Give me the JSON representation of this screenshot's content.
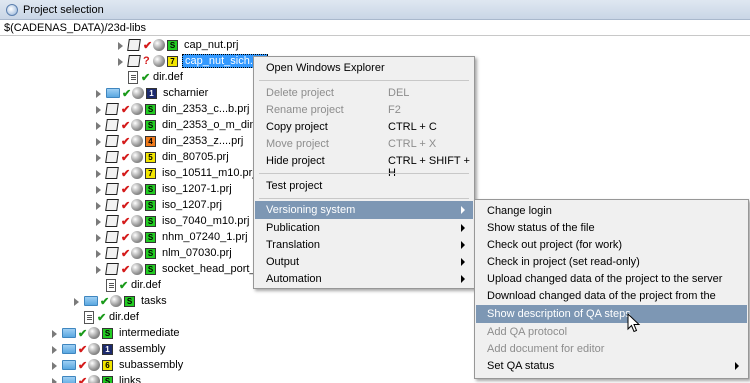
{
  "window": {
    "title": "Project selection"
  },
  "path": "$(CADENAS_DATA)/23d-libs",
  "tree": {
    "cap_nut": "cap_nut.prj",
    "cap_nut_sich": "cap_nut_sich.prj",
    "dirdef1": "dir.def",
    "scharnier": "scharnier",
    "din_2353_cb": "din_2353_c...b.prj",
    "din_2353_omdin": "din_2353_o_m_din_235",
    "din_2353_z": "din_2353_z....prj",
    "din_80705": "din_80705.prj",
    "iso_10511": "iso_10511_m10.prj",
    "iso_1207_1": "iso_1207-1.prj",
    "iso_1207": "iso_1207.prj",
    "iso_7040": "iso_7040_m10.prj",
    "nhm_07240": "nhm_07240_1.prj",
    "nlm_07030": "nlm_07030.prj",
    "socket": "socket_head_port_plug",
    "dirdef2": "dir.def",
    "tasks": "tasks",
    "dirdef3": "dir.def",
    "intermediate": "intermediate",
    "assembly": "assembly",
    "subassembly": "subassembly",
    "links": "links",
    "badges": {
      "cap_nut": "S",
      "cap_nut_sich": "7",
      "scharnier": "1",
      "din_2353_cb": "S",
      "din_2353_omdin": "S",
      "din_2353_z": "4",
      "din_80705": "5",
      "iso_10511": "7",
      "iso_1207_1": "S",
      "iso_1207": "S",
      "iso_7040": "S",
      "nhm_07240": "S",
      "nlm_07030": "S",
      "socket": "S",
      "tasks": "S",
      "intermediate": "S",
      "assembly": "1",
      "subassembly": "6",
      "links": "S"
    },
    "question_mark": "?"
  },
  "context_menu": {
    "open_explorer": "Open Windows Explorer",
    "delete": "Delete project",
    "delete_sc": "DEL",
    "rename": "Rename project",
    "rename_sc": "F2",
    "copy": "Copy project",
    "copy_sc": "CTRL + C",
    "move": "Move project",
    "move_sc": "CTRL + X",
    "hide": "Hide project",
    "hide_sc": "CTRL + SHIFT + H",
    "test": "Test project",
    "versioning": "Versioning system",
    "publication": "Publication",
    "translation": "Translation",
    "output": "Output",
    "automation": "Automation"
  },
  "submenu": {
    "change_login": "Change login",
    "show_status": "Show status of the file",
    "check_out": "Check out project (for work)",
    "check_in": "Check in project (set read-only)",
    "upload": "Upload changed data of the project to the server",
    "download": "Download changed data of the project from the server",
    "show_qa": "Show description of QA steps",
    "add_qa": "Add QA protocol",
    "add_doc": "Add document for editor",
    "set_qa": "Set QA status"
  },
  "colors": {
    "selection": "#3399ff",
    "menu_highlight": "#7d97b4",
    "badge_green": "#22cc22",
    "badge_yellow": "#f2e600",
    "badge_orange": "#f07a1a",
    "badge_navy": "#1c2a6e"
  }
}
